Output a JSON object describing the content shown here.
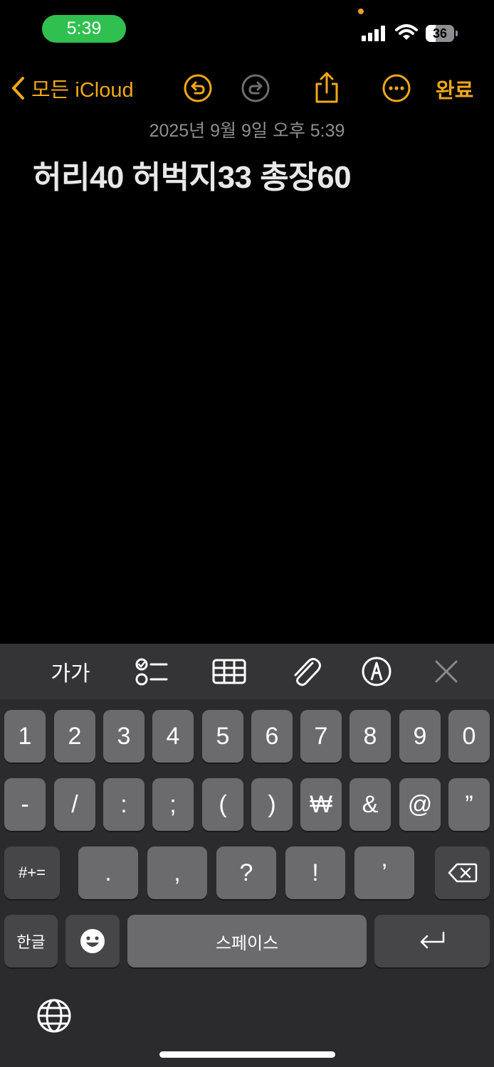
{
  "status_bar": {
    "time": "5:39",
    "battery_level": "36",
    "battery_fraction": 0.36
  },
  "nav": {
    "back_label": "모든 iCloud",
    "done_label": "완료",
    "icons": [
      "chevron-left-icon",
      "undo-icon",
      "redo-icon",
      "share-icon",
      "more-icon"
    ]
  },
  "note": {
    "date": "2025년 9월 9일 오후 5:39",
    "body": "허리40 허벅지33 총장60"
  },
  "toolbar": {
    "format_label": "가가",
    "icons": [
      "checklist-icon",
      "table-icon",
      "attachment-icon",
      "markup-icon",
      "close-icon"
    ]
  },
  "keyboard": {
    "row1": [
      "1",
      "2",
      "3",
      "4",
      "5",
      "6",
      "7",
      "8",
      "9",
      "0"
    ],
    "row2": [
      "-",
      "/",
      ":",
      ";",
      "(",
      ")",
      "₩",
      "&",
      "@",
      "”"
    ],
    "row3_shift": "#+=",
    "row3": [
      ".",
      ",",
      "?",
      "!",
      "’"
    ],
    "lang_key": "한글",
    "space_label": "스페이스"
  },
  "colors": {
    "accent": "#f0a81b",
    "status_time_bg": "#30c04f",
    "key_bg": "#6b6b6d",
    "keyboard_bg": "#2b2b2d"
  }
}
